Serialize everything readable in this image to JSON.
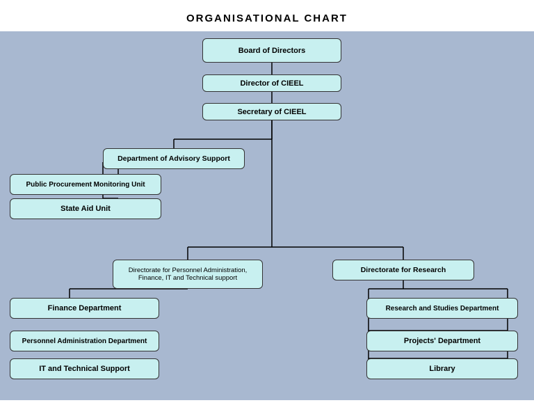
{
  "title": "ORGANISATIONAL CHART",
  "boxes": {
    "board": "Board of Directors",
    "director": "Director of CIEEL",
    "secretary": "Secretary of CIEEL",
    "advisory": "Department of Advisory Support",
    "procurement": "Public Procurement Monitoring Unit",
    "state_aid": "State Aid Unit",
    "dir_personnel": "Directorate for Personnel Administration, Finance, IT and Technical support",
    "dir_research": "Directorate for Research",
    "finance": "Finance Department",
    "personnel_admin": "Personnel Administration Department",
    "it_support": "IT and Technical Support",
    "research_studies": "Research and Studies Department",
    "projects": "Projects' Department",
    "library": "Library"
  }
}
